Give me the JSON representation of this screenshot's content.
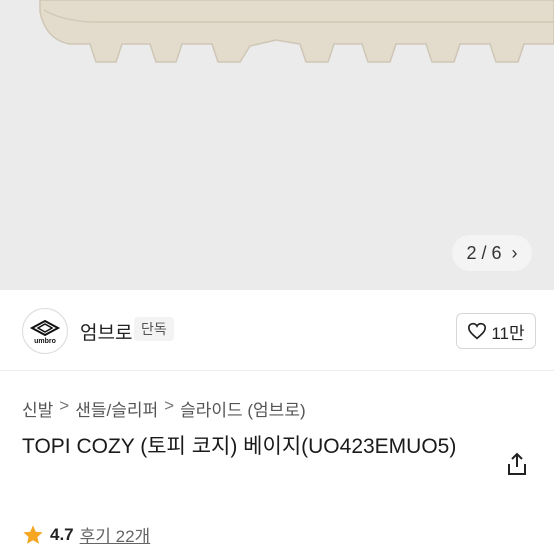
{
  "gallery": {
    "page_current": "2",
    "page_sep": "/",
    "page_total": "6",
    "next_icon": "chevron-right-icon"
  },
  "brand": {
    "logo_text": "umbro",
    "name": "엄브로",
    "badge": "단독",
    "like_count": "11만",
    "like_icon": "heart-outline-icon"
  },
  "breadcrumb": {
    "items": [
      "신발",
      "샌들/슬리퍼",
      "슬라이드 (엄브로)"
    ],
    "separator": ">"
  },
  "product": {
    "title": "TOPI COZY (토피 코지) 베이지(UO423EMUO5)",
    "share_icon": "share-icon"
  },
  "rating": {
    "score": "4.7",
    "reviews": "후기 22개",
    "star_color": "#f5a623"
  }
}
